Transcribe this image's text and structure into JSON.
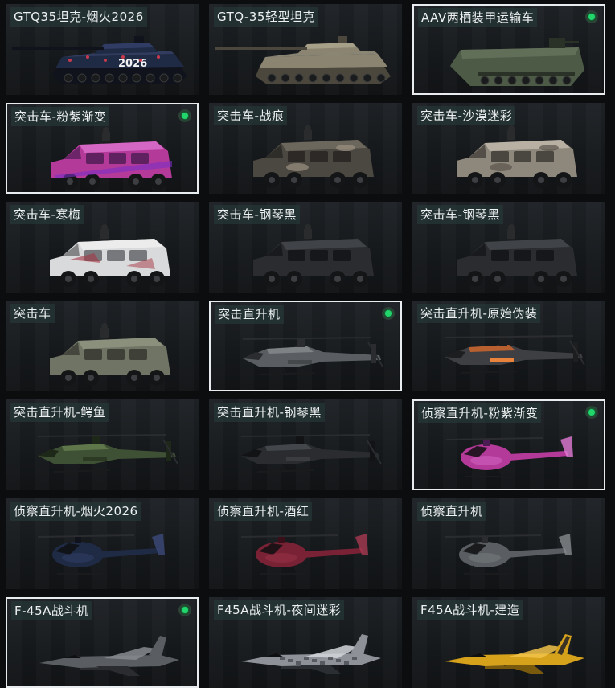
{
  "items": [
    {
      "label": "GTQ35坦克-烟火2026",
      "kind": "tank",
      "skin": "fireworks",
      "decal": "2026",
      "selected": false,
      "equipped": false
    },
    {
      "label": "GTQ-35轻型坦克",
      "kind": "tank",
      "skin": "desert",
      "selected": false,
      "equipped": false
    },
    {
      "label": "AAV两栖装甲运输车",
      "kind": "aav",
      "skin": "green",
      "selected": true,
      "equipped": true
    },
    {
      "label": "突击车-粉紫渐变",
      "kind": "truck",
      "skin": "pinkpurple",
      "selected": true,
      "equipped": true
    },
    {
      "label": "突击车-战痕",
      "kind": "truck",
      "skin": "battle",
      "selected": false,
      "equipped": false
    },
    {
      "label": "突击车-沙漠迷彩",
      "kind": "truck",
      "skin": "desertcamo",
      "selected": false,
      "equipped": false
    },
    {
      "label": "突击车-寒梅",
      "kind": "truck",
      "skin": "white",
      "selected": false,
      "equipped": false
    },
    {
      "label": "突击车-钢琴黑",
      "kind": "truck",
      "skin": "black",
      "selected": false,
      "equipped": false
    },
    {
      "label": "突击车-钢琴黑",
      "kind": "truck",
      "skin": "black",
      "selected": false,
      "equipped": false
    },
    {
      "label": "突击车",
      "kind": "truck",
      "skin": "olive",
      "selected": false,
      "equipped": false
    },
    {
      "label": "突击直升机",
      "kind": "apache",
      "skin": "grey",
      "selected": true,
      "equipped": true
    },
    {
      "label": "突击直升机-原始伪装",
      "kind": "apache",
      "skin": "orange",
      "selected": false,
      "equipped": false
    },
    {
      "label": "突击直升机-鳄鱼",
      "kind": "apache",
      "skin": "croc",
      "selected": false,
      "equipped": false
    },
    {
      "label": "突击直升机-钢琴黑",
      "kind": "apache",
      "skin": "black",
      "selected": false,
      "equipped": false
    },
    {
      "label": "侦察直升机-粉紫渐变",
      "kind": "scout",
      "skin": "pinkpurple",
      "selected": true,
      "equipped": true
    },
    {
      "label": "侦察直升机-烟火2026",
      "kind": "scout",
      "skin": "fireworks",
      "selected": false,
      "equipped": false
    },
    {
      "label": "侦察直升机-酒红",
      "kind": "scout",
      "skin": "wine",
      "selected": false,
      "equipped": false
    },
    {
      "label": "侦察直升机",
      "kind": "scout",
      "skin": "grey",
      "selected": false,
      "equipped": false
    },
    {
      "label": "F-45A战斗机",
      "kind": "jet",
      "skin": "grey",
      "selected": true,
      "equipped": true
    },
    {
      "label": "F45A战斗机-夜间迷彩",
      "kind": "jet",
      "skin": "nightcamo",
      "selected": false,
      "equipped": false
    },
    {
      "label": "F45A战斗机-建造",
      "kind": "jet",
      "skin": "yellow",
      "selected": false,
      "equipped": false
    }
  ],
  "colors": {
    "selected_border": "#e9ecee",
    "equipped_dot": "#21d66b",
    "label_bg": "#283e3e"
  }
}
